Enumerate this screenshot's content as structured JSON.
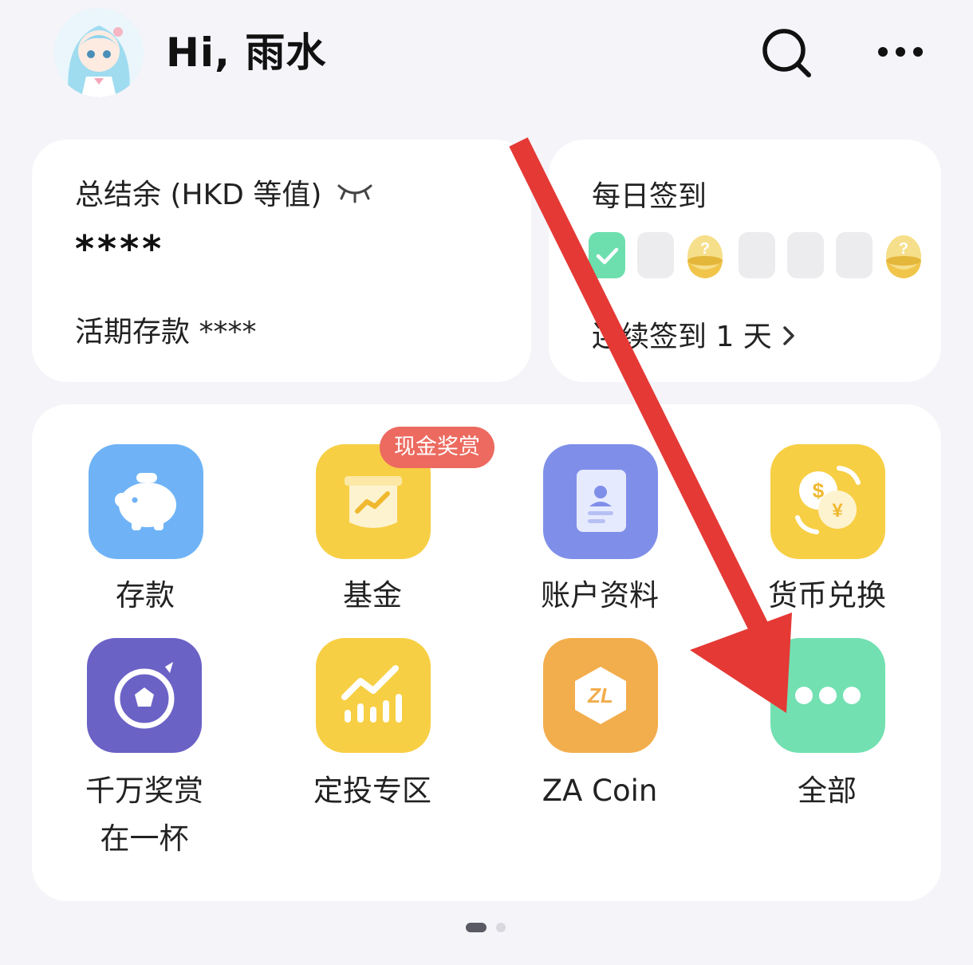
{
  "header": {
    "greeting": "Hi, 雨水",
    "avatar_icon": "anime-girl-avatar-icon",
    "search_icon": "search-icon",
    "more_icon": "more-dots-icon"
  },
  "balance_card": {
    "title": "总结余 (HKD 等值)",
    "visibility_icon": "eye-closed-icon",
    "total_masked": "****",
    "deposit_label": "活期存款",
    "deposit_masked": "****"
  },
  "checkin_card": {
    "title": "每日签到",
    "days": [
      {
        "state": "checked"
      },
      {
        "state": "empty"
      },
      {
        "state": "mystery-egg"
      },
      {
        "state": "empty"
      },
      {
        "state": "empty"
      },
      {
        "state": "empty"
      },
      {
        "state": "mystery-egg"
      }
    ],
    "streak_text": "连续签到 1 天",
    "streak_chevron": "chevron-right-icon"
  },
  "grid": {
    "items": [
      {
        "label": "存款",
        "icon": "piggy-bank-icon",
        "color": "#6fb3f6"
      },
      {
        "label": "基金",
        "icon": "fund-growth-icon",
        "color": "#f7cf44",
        "badge": "现金奖赏"
      },
      {
        "label": "账户资料",
        "icon": "account-profile-icon",
        "color": "#7f8fe9"
      },
      {
        "label": "货币兑换",
        "icon": "currency-exchange-icon",
        "color": "#f7cf44"
      },
      {
        "label": "千万奖赏",
        "label2": "在一杯",
        "icon": "football-icon",
        "color": "#6b62c6"
      },
      {
        "label": "定投专区",
        "icon": "bar-chart-icon",
        "color": "#f7cf44"
      },
      {
        "label": "ZA Coin",
        "icon": "za-coin-icon",
        "color": "#f2ad4c"
      },
      {
        "label": "全部",
        "icon": "more-dots-icon",
        "color": "#73e0b2"
      }
    ]
  },
  "pager": {
    "pages": 2,
    "current": 1
  },
  "annotation": {
    "type": "arrow",
    "color": "#e53935"
  }
}
